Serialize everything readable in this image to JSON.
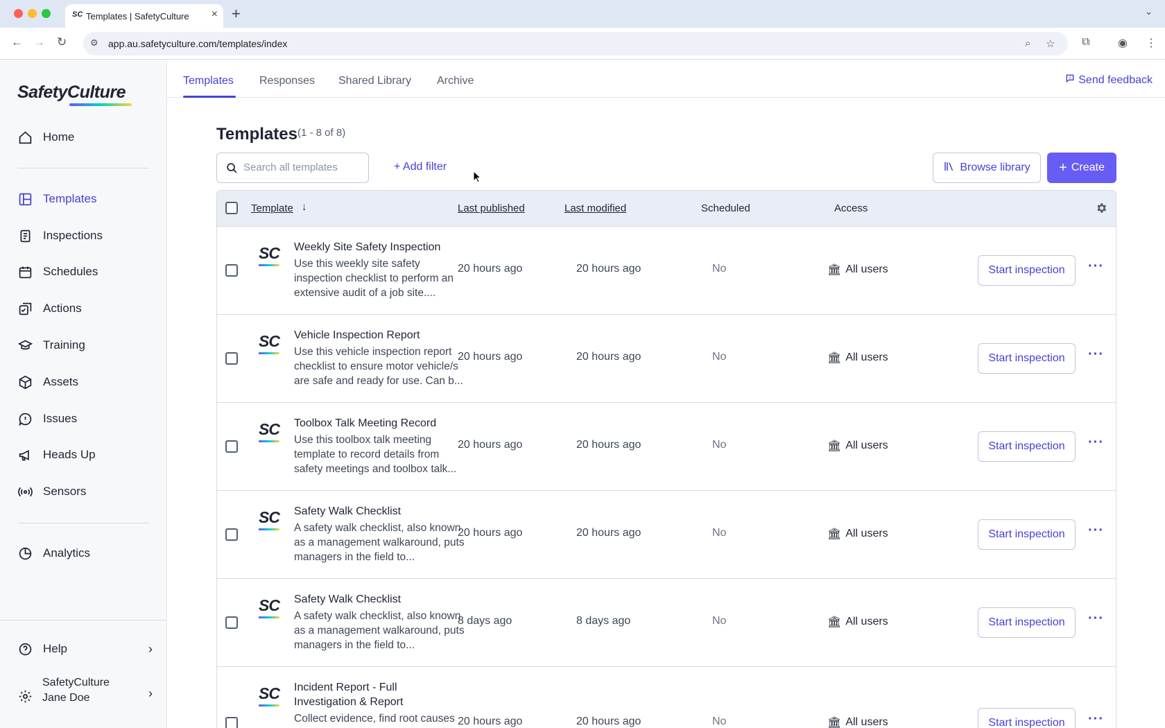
{
  "browser": {
    "tab_favicon": "SC",
    "tab_title": "Templates | SafetyCulture",
    "url": "app.au.safetyculture.com/templates/index"
  },
  "sidebar": {
    "logo": "SafetyCulture",
    "items": [
      {
        "label": "Home",
        "icon": "home-icon"
      },
      {
        "label": "Templates",
        "icon": "templates-icon",
        "active": true
      },
      {
        "label": "Inspections",
        "icon": "inspections-icon"
      },
      {
        "label": "Schedules",
        "icon": "calendar-icon"
      },
      {
        "label": "Actions",
        "icon": "actions-icon"
      },
      {
        "label": "Training",
        "icon": "graduation-cap-icon"
      },
      {
        "label": "Assets",
        "icon": "cube-icon"
      },
      {
        "label": "Issues",
        "icon": "alert-icon"
      },
      {
        "label": "Heads Up",
        "icon": "megaphone-icon"
      },
      {
        "label": "Sensors",
        "icon": "sensor-icon"
      },
      {
        "label": "Analytics",
        "icon": "pie-chart-icon"
      }
    ],
    "help": "Help",
    "user": {
      "org": "SafetyCulture",
      "name": "Jane Doe"
    }
  },
  "top_tabs": [
    "Templates",
    "Responses",
    "Shared Library",
    "Archive"
  ],
  "feedback": "Send feedback",
  "page": {
    "title": "Templates",
    "count": "(1 - 8 of 8)",
    "search_placeholder": "Search all templates",
    "add_filter": "+ Add filter",
    "browse_library": "Browse library",
    "create": "Create"
  },
  "table": {
    "headers": {
      "template": "Template",
      "last_published": "Last published",
      "last_modified": "Last modified",
      "scheduled": "Scheduled",
      "access": "Access"
    },
    "start_label": "Start inspection",
    "rows": [
      {
        "title": "Weekly Site Safety Inspection",
        "desc": "Use this weekly site safety inspection checklist to perform an extensive audit of a job site....",
        "published": "20 hours ago",
        "modified": "20 hours ago",
        "scheduled": "No",
        "access": "All users"
      },
      {
        "title": "Vehicle Inspection Report",
        "desc": "Use this vehicle inspection report checklist to ensure motor vehicle/s are safe and ready for use. Can b...",
        "published": "20 hours ago",
        "modified": "20 hours ago",
        "scheduled": "No",
        "access": "All users"
      },
      {
        "title": "Toolbox Talk Meeting Record",
        "desc": "Use this toolbox talk meeting template to record details from safety meetings and toolbox talk...",
        "published": "20 hours ago",
        "modified": "20 hours ago",
        "scheduled": "No",
        "access": "All users"
      },
      {
        "title": "Safety Walk Checklist",
        "desc": "A safety walk checklist, also known as a management walkaround, puts managers in the field to...",
        "published": "20 hours ago",
        "modified": "20 hours ago",
        "scheduled": "No",
        "access": "All users"
      },
      {
        "title": "Safety Walk Checklist",
        "desc": "A safety walk checklist, also known as a management walkaround, puts managers in the field to...",
        "published": "8 days ago",
        "modified": "8 days ago",
        "scheduled": "No",
        "access": "All users"
      },
      {
        "title": "Incident Report - Full Investigation & Report",
        "desc": "Collect evidence, find root causes",
        "published": "20 hours ago",
        "modified": "20 hours ago",
        "scheduled": "No",
        "access": "All users"
      }
    ]
  },
  "colors": {
    "accent": "#4740d4",
    "create_button": "#675df4",
    "header_bg": "#e9edf6"
  }
}
